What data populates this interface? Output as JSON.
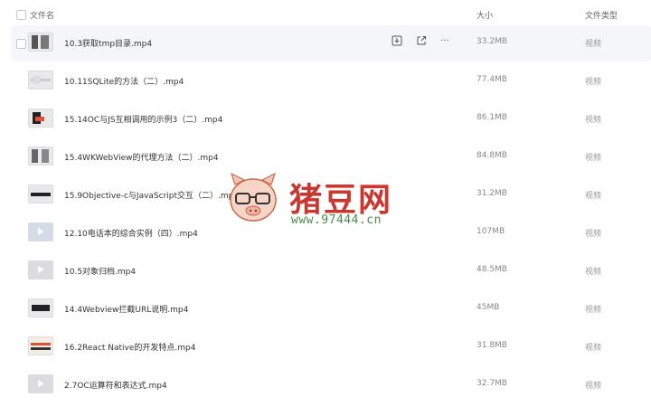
{
  "header": {
    "name_label": "文件名",
    "size_label": "大小",
    "type_label": "文件类型"
  },
  "rows": [
    {
      "name": "10.3获取tmp目录.mp4",
      "size": "33.2MB",
      "type": "视频"
    },
    {
      "name": "10.11SQLite的方法（二）.mp4",
      "size": "77.4MB",
      "type": "视频"
    },
    {
      "name": "15.14OC与JS互相调用的示例3（二）.mp4",
      "size": "86.1MB",
      "type": "视频"
    },
    {
      "name": "15.4WKWebView的代理方法（二）.mp4",
      "size": "84.8MB",
      "type": "视频"
    },
    {
      "name": "15.9Objective-c与JavaScript交互（二）.mp4",
      "size": "31.2MB",
      "type": "视频"
    },
    {
      "name": "12.10电话本的综合实例（四）.mp4",
      "size": "107MB",
      "type": "视频"
    },
    {
      "name": "10.5对象归档.mp4",
      "size": "48.5MB",
      "type": "视频"
    },
    {
      "name": "14.4Webview拦截URL说明.mp4",
      "size": "45MB",
      "type": "视频"
    },
    {
      "name": "16.2React Native的开发特点.mp4",
      "size": "31.8MB",
      "type": "视频"
    },
    {
      "name": "2.7OC运算符和表达式.mp4",
      "size": "32.7MB",
      "type": "视频"
    }
  ],
  "row_actions": {
    "download_icon": "download-icon",
    "share_icon": "share-icon",
    "more_label": "···"
  },
  "watermark": {
    "title": "猪豆网",
    "url": "www.97444.cn"
  }
}
